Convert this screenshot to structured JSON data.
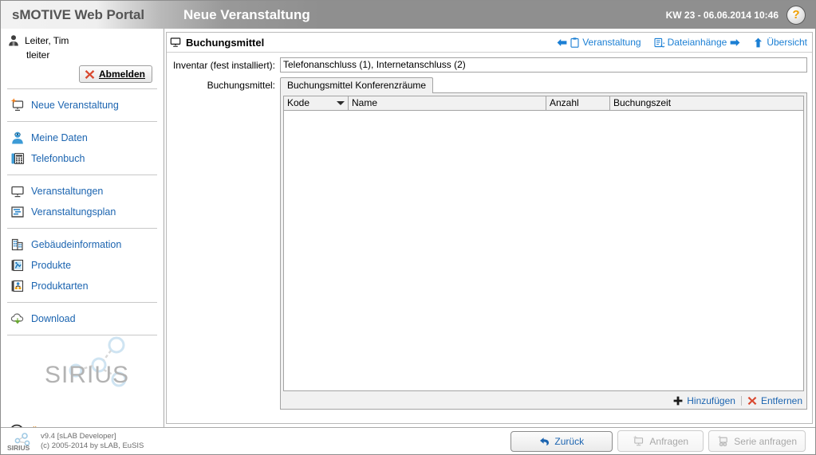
{
  "header": {
    "brand": "sMOTIVE Web Portal",
    "page_title": "Neue Veranstaltung",
    "kw_date": "KW 23 - 06.06.2014 10:46",
    "help_icon": "help-question-icon",
    "help_label": "?"
  },
  "sidebar": {
    "user": {
      "name": "Leiter, Tim",
      "login": "tleiter",
      "logout_label": "Abmelden",
      "logout_icon": "red-x-icon",
      "user_icon": "user-icon"
    },
    "items": [
      {
        "label": "Neue Veranstaltung",
        "icon": "new-event-icon"
      },
      {
        "label": "Meine Daten",
        "icon": "person-data-icon"
      },
      {
        "label": "Telefonbuch",
        "icon": "phonebook-icon"
      },
      {
        "label": "Veranstaltungen",
        "icon": "monitor-icon"
      },
      {
        "label": "Veranstaltungsplan",
        "icon": "schedule-icon"
      },
      {
        "label": "Gebäudeinformation",
        "icon": "building-icon"
      },
      {
        "label": "Produkte",
        "icon": "product-icon"
      },
      {
        "label": "Produktarten",
        "icon": "product-types-icon"
      },
      {
        "label": "Download",
        "icon": "download-cloud-icon"
      }
    ],
    "logo_text": "SIRIUS",
    "about_label": "Über sMOTIVE",
    "about_icon": "info-exclamation-icon"
  },
  "footer": {
    "logo_text": "SIRIUS",
    "version": "v9.4 [sLAB Developer]",
    "copyright": "(c) 2005-2014 by sLAB, EuSIS",
    "buttons": [
      {
        "label": "Zurück",
        "icon": "back-arrow-icon",
        "disabled": false
      },
      {
        "label": "Anfragen",
        "icon": "request-icon",
        "disabled": true
      },
      {
        "label": "Serie anfragen",
        "icon": "series-request-icon",
        "disabled": true
      }
    ]
  },
  "content": {
    "title": "Buchungsmittel",
    "title_icon": "projector-icon",
    "nav_links": [
      {
        "label": "Veranstaltung",
        "icon": "clipboard-icon",
        "arrow": "left"
      },
      {
        "label": "Dateianhänge",
        "icon": "attachment-icon",
        "arrow": "right"
      },
      {
        "label": "Übersicht",
        "icon": "up-arrow-icon",
        "arrow": "none"
      }
    ],
    "inventar": {
      "label": "Inventar (fest installiert):",
      "value": "Telefonanschluss (1), Internetanschluss (2)"
    },
    "buchungsmittel": {
      "label": "Buchungsmittel:",
      "tab_label": "Buchungsmittel Konferenzräume",
      "columns": [
        "Kode",
        "Name",
        "Anzahl",
        "Buchungszeit"
      ],
      "rows": [],
      "actions": [
        {
          "label": "Hinzufügen",
          "icon": "plus-icon"
        },
        {
          "label": "Entfernen",
          "icon": "red-x-icon"
        }
      ]
    }
  },
  "colors": {
    "link": "#1b64b0",
    "nav_link": "#1b7fd4",
    "accent_orange": "#e08a1e",
    "header_gray": "#8f8f8f",
    "help_yellow": "#f0a000"
  }
}
